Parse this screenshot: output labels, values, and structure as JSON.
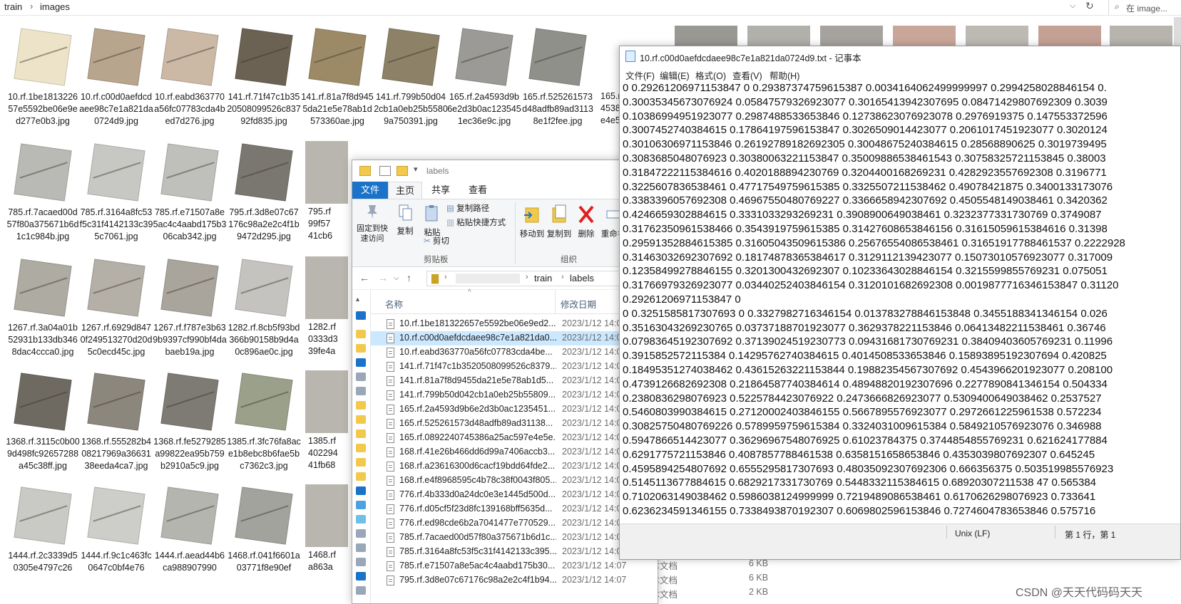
{
  "background_explorer": {
    "breadcrumb": [
      "train",
      "images"
    ],
    "search_placeholder": "在 image...",
    "thumbnails": [
      {
        "caption": "10.rf.1be181322657e5592be06e9ed277e0b3.jpg",
        "color": "#ece3c9"
      },
      {
        "caption": "10.rf.c00d0aefdcdaee98c7e1a821da0724d9.jpg",
        "color": "#b8a58e"
      },
      {
        "caption": "10.rf.eabd363770a56fc07783cda4bed7d276.jpg",
        "color": "#cbb9a6"
      },
      {
        "caption": "141.rf.71f47c1b3520508099526c83792fd835.jpg",
        "color": "#6b6253"
      },
      {
        "caption": "141.rf.81a7f8d9455da21e5e78ab1d573360ae.jpg",
        "color": "#9c8a66"
      },
      {
        "caption": "141.rf.799b50d042cb1a0eb25b55809a750391.jpg",
        "color": "#8d8167"
      },
      {
        "caption": "165.rf.2a4593d9b6e2d3b0ac1235451ec36e9c.jpg",
        "color": "#9b9a96"
      },
      {
        "caption": "165.rf.525261573d48adfb89ad31138e1f2fee.jpg",
        "color": "#8f9089"
      },
      {
        "caption": "785.rf.7acaed00d57f80a375671b6d1c1c984b.jpg",
        "color": "#b9b9b5"
      },
      {
        "caption": "785.rf.3164a8fc53f5c31f4142133c395c7061.jpg",
        "color": "#c7c7c3"
      },
      {
        "caption": "785.rf.e71507a8e5ac4c4aabd175b306cab342.jpg",
        "color": "#bfbfbb"
      },
      {
        "caption": "795.rf.3d8e07c67176c98a2e2c4f1b9472d295.jpg",
        "color": "#7a7770"
      },
      {
        "caption": "1267.rf.3a04a01b52931b133db3468dac4ccca0.jpg",
        "color": "#aeaba3"
      },
      {
        "caption": "1267.rf.6929d8470f249513270d20d5c0ecd45c.jpg",
        "color": "#b4b0a8"
      },
      {
        "caption": "1267.rf.f787e3b639b9397cf990bf4dabaeb19a.jpg",
        "color": "#a9a59d"
      },
      {
        "caption": "1282.rf.8cb5f93bd366b90158b9d4a0c896ae0c.jpg",
        "color": "#c4c3bf"
      },
      {
        "caption": "1368.rf.3115c0b009d498fc92657288a45c38ff.jpg",
        "color": "#6e6a62"
      },
      {
        "caption": "1368.rf.555282b408217969a3663138eeda4ca7.jpg",
        "color": "#8c877d"
      },
      {
        "caption": "1368.rf.fe5279285a99822ea95b759b2910a5c9.jpg",
        "color": "#7e7b74"
      },
      {
        "caption": "1385.rf.3fc76fa8ace1b8ebc8b6fae5bc7362c3.jpg",
        "color": "#9ba08a"
      },
      {
        "caption": "1444.rf.2c3339d50305e4797c26",
        "color": "#c9c9c5"
      },
      {
        "caption": "1444.rf.9c1c463fc0647c0bf4e76",
        "color": "#cdcdc9"
      },
      {
        "caption": "1444.rf.aead44b6ca988907990",
        "color": "#b5b5b0"
      },
      {
        "caption": "1468.rf.041f6601a03771f8e90ef",
        "color": "#a3a39e"
      }
    ],
    "partial_captions": [
      "165.rf",
      "4538",
      "e4e5",
      "795.rf",
      "99f57",
      "41cb6",
      "1282.rf",
      "0333d3",
      "39fe4a",
      "1385.rf",
      "402294",
      "41fb68",
      "1468.rf",
      "a863a"
    ]
  },
  "labels_window": {
    "title": "labels",
    "tabs": [
      "文件",
      "主页",
      "共享",
      "查看"
    ],
    "ribbon": {
      "pin": "固定到快速访问",
      "copy": "复制",
      "paste": "粘贴",
      "copy_path": "复制路径",
      "paste_shortcut": "粘贴快捷方式",
      "cut": "剪切",
      "clipboard_group": "剪贴板",
      "move_to": "移动到",
      "copy_to": "复制到",
      "delete": "删除",
      "rename": "重命名",
      "organize_group": "组织"
    },
    "path": [
      "train",
      "labels"
    ],
    "columns": {
      "name": "名称",
      "date": "修改日期"
    },
    "rows": [
      {
        "name": "10.rf.1be181322657e5592be06e9ed2...",
        "date": "2023/1/12 14:0"
      },
      {
        "name": "10.rf.c00d0aefdcdaee98c7e1a821da0...",
        "date": "2023/1/12 14:0"
      },
      {
        "name": "10.rf.eabd363770a56fc07783cda4be...",
        "date": "2023/1/12 14:0"
      },
      {
        "name": "141.rf.71f47c1b3520508099526c8379...",
        "date": "2023/1/12 14:0"
      },
      {
        "name": "141.rf.81a7f8d9455da21e5e78ab1d5...",
        "date": "2023/1/12 14:0"
      },
      {
        "name": "141.rf.799b50d042cb1a0eb25b55809...",
        "date": "2023/1/12 14:0"
      },
      {
        "name": "165.rf.2a4593d9b6e2d3b0ac1235451...",
        "date": "2023/1/12 14:0"
      },
      {
        "name": "165.rf.525261573d48adfb89ad31138...",
        "date": "2023/1/12 14:0"
      },
      {
        "name": "165.rf.0892240745386a25ac597e4e5e...",
        "date": "2023/1/12 14:0"
      },
      {
        "name": "168.rf.41e26b466dd6d99a7406accb3...",
        "date": "2023/1/12 14:0"
      },
      {
        "name": "168.rf.a23616300d6cacf19bdd64fde2...",
        "date": "2023/1/12 14:0"
      },
      {
        "name": "168.rf.e4f8968595c4b78c38f0043f805...",
        "date": "2023/1/12 14:0"
      },
      {
        "name": "776.rf.4b333d0a24dc0e3e1445d500d...",
        "date": "2023/1/12 14:0"
      },
      {
        "name": "776.rf.d05cf5f23d8fc139168bff5635d...",
        "date": "2023/1/12 14:0"
      },
      {
        "name": "776.rf.ed98cde6b2a7041477e770529...",
        "date": "2023/1/12 14:0"
      },
      {
        "name": "785.rf.7acaed00d57f80a375671b6d1c...",
        "date": "2023/1/12 14:0"
      },
      {
        "name": "785.rf.3164a8fc53f5c31f4142133c395...",
        "date": "2023/1/12 14:07"
      },
      {
        "name": "785.rf.e71507a8e5ac4c4aabd175b30...",
        "date": "2023/1/12 14:07"
      },
      {
        "name": "795.rf.3d8e07c67176c98a2e2c4f1b94...",
        "date": "2023/1/12 14:07"
      }
    ],
    "extra_columns": [
      {
        "type": "文本文档",
        "size": "6 KB"
      },
      {
        "type": "文本文档",
        "size": "6 KB"
      },
      {
        "type": "文本文档",
        "size": "2 KB"
      }
    ]
  },
  "notepad": {
    "title": "10.rf.c00d0aefdcdaee98c7e1a821da0724d9.txt - 记事本",
    "menu": [
      "文件(F)",
      "编辑(E)",
      "格式(O)",
      "查看(V)",
      "帮助(H)"
    ],
    "lines": [
      "0 0.29261206971153847 0 0.29387374759615387 0.0034164062499999997 0.2994258028846154 0.",
      "0.30035345673076924 0.05847579326923077 0.30165413942307695 0.08471429807692309 0.3039",
      "0.10386994951923077 0.2987488533653846 0.12738623076923078 0.2976919375 0.147553372596",
      "0.3007452740384615 0.17864197596153847 0.3026509014423077 0.2061017451923077 0.3020124",
      "0.30106306971153846 0.26192789182692305 0.30048675240384615 0.28568890625 0.3019739495",
      "0.3083685048076923 0.30380063221153847 0.35009886538461543 0.30758325721153845 0.38003",
      "0.31847222115384616 0.4020188894230769 0.3204400168269231 0.4282923557692308 0.3196771",
      "0.3225607836538461 0.47717549759615385 0.3325507211538462 0.49078421875 0.3400133173076",
      "0.3383396057692308 0.46967550480769227 0.3366658942307692 0.4505548149038461 0.3420362",
      "0.4246659302884615 0.3331033293269231 0.3908900649038461 0.3232377331730769 0.3749087",
      "0.31762350961538466 0.3543919759615385 0.31427608653846156 0.31615059615384616 0.31398",
      "0.29591352884615385 0.31605043509615386 0.25676554086538461 0.31651917788461537 0.2222928",
      "0.31463032692307692 0.18174878365384617 0.3129112139423077 0.15073010576923077 0.317009",
      "0.12358499278846155 0.3201300432692307 0.10233643028846154 0.3215599855769231 0.075051",
      "0.31766979326923077 0.03440252403846154 0.3120101682692308 0.0019877716346153847 0.31120",
      "0.29261206971153847 0",
      "0 0.3251585817307693 0 0.3327982716346154 0.013783278846153848 0.3455188341346154 0.026",
      "0.35163043269230765 0.03737188701923077 0.3629378221153846 0.06413482211538461 0.36746",
      "0.07983645192307692 0.37139024519230773 0.09431681730769231 0.38409403605769231 0.11996",
      "0.3915852572115384 0.14295762740384615 0.4014508533653846 0.15893895192307694 0.420825",
      "0.18495351274038462 0.43615263221153844 0.19882354567307692 0.4543966201923077 0.208100",
      "0.4739126682692308 0.21864587740384614 0.48948820192307696 0.2277890841346154 0.504334",
      "0.2380836298076923 0.5225784423076922 0.2473666826923077 0.5309400649038462 0.2537527",
      "0.5460803990384615 0.27120002403846155 0.5667895576923077 0.2972661225961538 0.572234",
      "0.30825750480769226 0.5789959759615384 0.3324031009615384 0.5849210576923076 0.346988",
      "0.5947866514423077 0.36296967548076925 0.61023784375 0.3744854855769231 0.621624177884",
      "0.6291775721153846 0.4087857788461538 0.6358151658653846 0.4353039807692307 0.645245",
      "0.4595894254807692 0.6555295817307693 0.48035092307692306 0.666356375 0.503519985576923",
      "0.5145113677884615 0.6829217331730769 0.5448332115384615 0.68920307211538 47 0.565384",
      "0.7102063149038462 0.5986038124999999 0.7219489086538461 0.6170626298076923 0.733641",
      "0.6236234591346155 0.7338493870192307 0.6069802596153846 0.7274604783653846 0.575716"
    ],
    "status_encoding": "Unix (LF)",
    "status_position": "第 1 行，第 1"
  },
  "watermark": "CSDN @天天代码码天天"
}
